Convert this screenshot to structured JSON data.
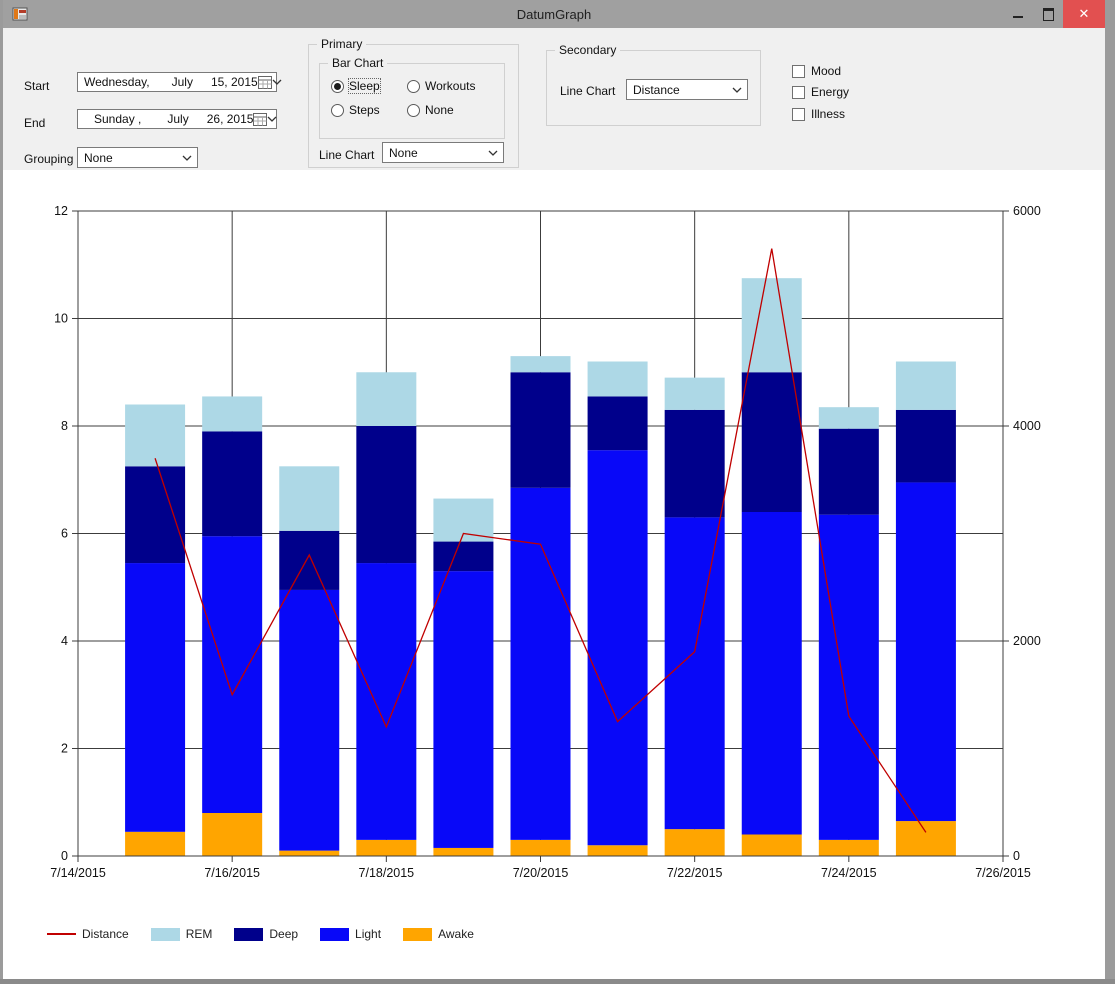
{
  "window": {
    "title": "DatumGraph",
    "buttons": {
      "minimize_glyph": "",
      "close_glyph": "✕"
    },
    "close_color": "#e25050"
  },
  "controls": {
    "start": {
      "label": "Start",
      "weekday": "Wednesday,",
      "month": "July",
      "day_year": "15, 2015"
    },
    "end": {
      "label": "End",
      "weekday": "Sunday ,",
      "month": "July",
      "day_year": "26, 2015"
    },
    "grouping": {
      "label": "Grouping",
      "value": "None"
    }
  },
  "primary": {
    "label": "Primary",
    "bar_chart": {
      "label": "Bar Chart",
      "options": [
        {
          "label": "Sleep",
          "selected": true
        },
        {
          "label": "Workouts",
          "selected": false
        },
        {
          "label": "Steps",
          "selected": false
        },
        {
          "label": "None",
          "selected": false
        }
      ]
    },
    "line_chart": {
      "label": "Line Chart",
      "value": "None"
    }
  },
  "secondary": {
    "label": "Secondary",
    "line_chart": {
      "label": "Line Chart",
      "value": "Distance"
    }
  },
  "checkboxes": [
    {
      "label": "Mood",
      "checked": false
    },
    {
      "label": "Energy",
      "checked": false
    },
    {
      "label": "Illness",
      "checked": false
    }
  ],
  "chart_data": {
    "type": "bar",
    "bar_mode": "stacked",
    "categories": [
      "7/15/2015",
      "7/16/2015",
      "7/17/2015",
      "7/18/2015",
      "7/19/2015",
      "7/20/2015",
      "7/21/2015",
      "7/22/2015",
      "7/23/2015",
      "7/24/2015",
      "7/25/2015"
    ],
    "series": [
      {
        "name": "Awake",
        "color": "#FFA500",
        "values": [
          0.45,
          0.8,
          0.1,
          0.3,
          0.15,
          0.3,
          0.2,
          0.5,
          0.4,
          0.3,
          0.65
        ]
      },
      {
        "name": "Light",
        "color": "#0808F8",
        "values": [
          5.0,
          5.15,
          4.85,
          5.15,
          5.15,
          6.55,
          7.35,
          5.8,
          6.0,
          6.05,
          6.3
        ]
      },
      {
        "name": "Deep",
        "color": "#00008B",
        "values": [
          1.8,
          1.95,
          1.1,
          2.55,
          0.55,
          2.15,
          1.0,
          2.0,
          2.6,
          1.6,
          1.35
        ]
      },
      {
        "name": "REM",
        "color": "#ADD8E6",
        "values": [
          1.15,
          0.65,
          1.2,
          1.0,
          0.8,
          0.3,
          0.65,
          0.6,
          1.75,
          0.4,
          0.9
        ]
      }
    ],
    "bar_totals": [
      8.4,
      8.55,
      7.25,
      9.0,
      6.65,
      9.3,
      9.2,
      8.9,
      10.75,
      8.3,
      9.2
    ],
    "line_series": {
      "name": "Distance",
      "color": "#C00000",
      "axis": "right",
      "values": [
        3700,
        1500,
        2800,
        1200,
        3000,
        2900,
        1250,
        1900,
        5650,
        1300,
        220
      ]
    },
    "left_axis": {
      "min": 0,
      "max": 12,
      "step": 2,
      "tick_labels": [
        "0",
        "2",
        "4",
        "6",
        "8",
        "10",
        "12"
      ]
    },
    "right_axis": {
      "min": 0,
      "max": 6000,
      "step": 2000,
      "tick_labels": [
        "0",
        "2000",
        "4000",
        "6000"
      ]
    },
    "x_axis": {
      "total_days": 13,
      "tick_labels": [
        "7/14/2015",
        "7/16/2015",
        "7/18/2015",
        "7/20/2015",
        "7/22/2015",
        "7/24/2015",
        "7/26/2015"
      ]
    },
    "grid": true,
    "legend_position": "bottom-left",
    "legend": [
      "Distance",
      "REM",
      "Deep",
      "Light",
      "Awake"
    ]
  }
}
